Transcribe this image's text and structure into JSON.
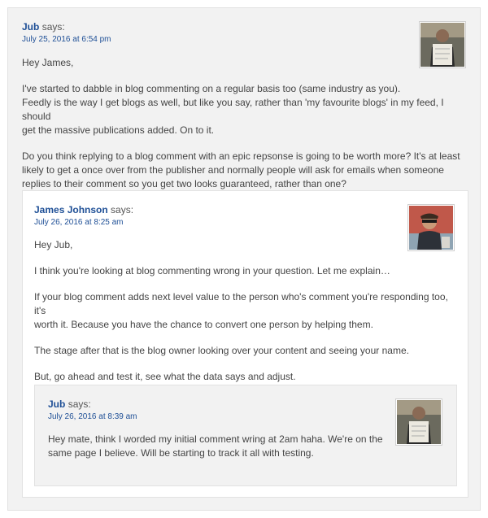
{
  "comments": {
    "c1": {
      "author": "Jub",
      "says": "says:",
      "date": "July 25, 2016 at 6:54 pm",
      "paragraphs": [
        "Hey James,",
        "I've started to dabble in blog commenting on a regular basis too (same industry as you).",
        "Feedly is the way I get blogs as well, but like you say, rather than 'my favourite blogs' in my feed, I should",
        "get the massive publications added. On to it.",
        "Do you think replying to a blog comment with an epic repsonse is going to be worth more? It's at least",
        "likely to get a once over from the publisher and normally people will ask for emails when someone",
        "replies to their comment so you get two looks guaranteed, rather than one?"
      ]
    },
    "c2": {
      "author": "James Johnson",
      "says": "says:",
      "date": "July 26, 2016 at 8:25 am",
      "paragraphs": [
        "Hey Jub,",
        "I think you're looking at blog commenting wrong in your question. Let me explain…",
        "If your blog comment adds next level value to the person who's comment you're responding too, it's",
        "worth it. Because you have the chance to convert one person by helping them.",
        "The stage after that is the blog owner looking over your content and seeing your name.",
        "But, go ahead and test it, see what the data says and adjust."
      ]
    },
    "c3": {
      "author": "Jub",
      "says": "says:",
      "date": "July 26, 2016 at 8:39 am",
      "paragraphs": [
        "Hey mate, think I worded my initial comment wring at 2am haha. We're on the",
        "same page I believe. Will be starting to track it all with testing."
      ]
    }
  },
  "colors": {
    "link": "#1e4f96",
    "panel_grey": "#f2f2f2",
    "panel_white": "#ffffff"
  },
  "icons": {
    "avatar_c1": "avatar-photo",
    "avatar_c2": "avatar-photo",
    "avatar_c3": "avatar-photo"
  }
}
